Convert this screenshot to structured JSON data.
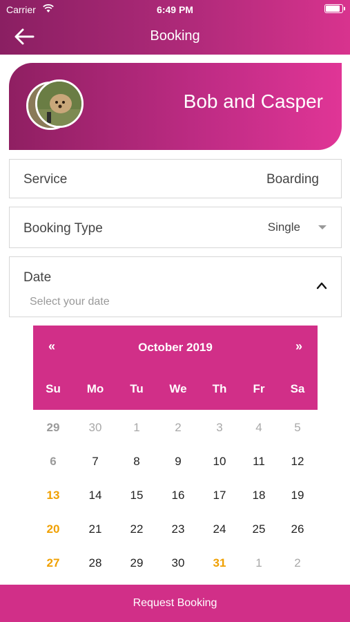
{
  "status_bar": {
    "carrier": "Carrier",
    "time": "6:49 PM"
  },
  "nav": {
    "title": "Booking",
    "back_icon": "arrow-left-icon"
  },
  "profile": {
    "name": "Bob and Casper"
  },
  "service": {
    "label": "Service",
    "value": "Boarding"
  },
  "booking_type": {
    "label": "Booking Type",
    "value": "Single"
  },
  "date": {
    "label": "Date",
    "placeholder": "Select your date"
  },
  "calendar": {
    "prev": "«",
    "next": "»",
    "month": "October 2019",
    "weekdays": [
      "Su",
      "Mo",
      "Tu",
      "We",
      "Th",
      "Fr",
      "Sa"
    ],
    "weeks": [
      [
        "29",
        "30",
        "1",
        "2",
        "3",
        "4",
        "5"
      ],
      [
        "6",
        "7",
        "8",
        "9",
        "10",
        "11",
        "12"
      ],
      [
        "13",
        "14",
        "15",
        "16",
        "17",
        "18",
        "19"
      ],
      [
        "20",
        "21",
        "22",
        "23",
        "24",
        "25",
        "26"
      ],
      [
        "27",
        "28",
        "29",
        "30",
        "31",
        "1",
        "2"
      ]
    ],
    "today": "31"
  },
  "footer": {
    "label": "Request Booking"
  },
  "colors": {
    "accent": "#d12f88",
    "header_dark": "#8a1f62",
    "highlight": "#f0a000"
  }
}
